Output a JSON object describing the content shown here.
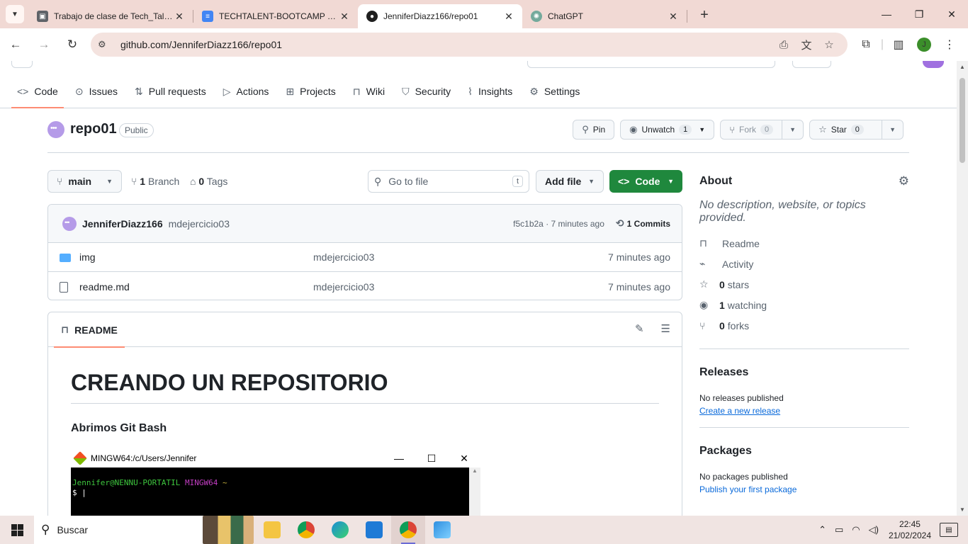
{
  "browser": {
    "tabs": [
      {
        "title": "Trabajo de clase de Tech_Talent",
        "favicon": "classroom-icon",
        "color": "#5f6368"
      },
      {
        "title": "TECHTALENT-BOOTCAMP - Doc",
        "favicon": "docs-icon",
        "color": "#4285f4"
      },
      {
        "title": "JenniferDiazz166/repo01",
        "favicon": "github-icon",
        "color": "#1f1f1f",
        "active": true
      },
      {
        "title": "ChatGPT",
        "favicon": "chatgpt-icon",
        "color": "#74aa9c"
      }
    ],
    "new_tab": "+",
    "url": "github.com/JenniferDiazz166/repo01",
    "profile_initial": "J"
  },
  "repo_nav": [
    {
      "label": "Code",
      "icon": "code-icon",
      "selected": true
    },
    {
      "label": "Issues",
      "icon": "issue-icon"
    },
    {
      "label": "Pull requests",
      "icon": "pull-request-icon"
    },
    {
      "label": "Actions",
      "icon": "play-icon"
    },
    {
      "label": "Projects",
      "icon": "table-icon"
    },
    {
      "label": "Wiki",
      "icon": "book-icon"
    },
    {
      "label": "Security",
      "icon": "shield-icon"
    },
    {
      "label": "Insights",
      "icon": "graph-icon"
    },
    {
      "label": "Settings",
      "icon": "gear-icon"
    }
  ],
  "repo": {
    "name": "repo01",
    "visibility": "Public",
    "pin": "Pin",
    "watch": {
      "label": "Unwatch",
      "count": "1"
    },
    "fork": {
      "label": "Fork",
      "count": "0"
    },
    "star": {
      "label": "Star",
      "count": "0"
    }
  },
  "filenav": {
    "branch": "main",
    "branches_count": "1",
    "branches_label": "Branch",
    "tags_count": "0",
    "tags_label": "Tags",
    "goto_placeholder": "Go to file",
    "goto_kbd": "t",
    "add_file": "Add file",
    "code": "Code"
  },
  "commit": {
    "author": "JenniferDiazz166",
    "message": "mdejercicio03",
    "sha_time": "f5c1b2a · 7 minutes ago",
    "commits": "1 Commits"
  },
  "files": [
    {
      "name": "img",
      "type": "folder",
      "message": "mdejercicio03",
      "date": "7 minutes ago"
    },
    {
      "name": "readme.md",
      "type": "file",
      "message": "mdejercicio03",
      "date": "7 minutes ago"
    }
  ],
  "readme": {
    "tab": "README",
    "h1": "CREANDO UN REPOSITORIO",
    "h3": "Abrimos Git Bash",
    "gitbash": {
      "title": "MINGW64:/c/Users/Jennifer",
      "user": "Jennifer@NENNU-PORTATIL",
      "env": "MINGW64",
      "path": "~",
      "prompt": "$ |"
    }
  },
  "about": {
    "title": "About",
    "description": "No description, website, or topics provided.",
    "items": [
      {
        "icon": "book-icon",
        "bold": "",
        "label": "Readme"
      },
      {
        "icon": "pulse-icon",
        "bold": "",
        "label": "Activity"
      },
      {
        "icon": "star-icon",
        "bold": "0",
        "label": "stars"
      },
      {
        "icon": "eye-icon",
        "bold": "1",
        "label": "watching"
      },
      {
        "icon": "fork-icon",
        "bold": "0",
        "label": "forks"
      }
    ]
  },
  "releases": {
    "title": "Releases",
    "empty": "No releases published",
    "link": "Create a new release"
  },
  "packages": {
    "title": "Packages",
    "empty": "No packages published",
    "link": "Publish your first package"
  },
  "taskbar": {
    "search": "Buscar",
    "apps": [
      {
        "name": "file-explorer-icon",
        "color": "#f4c542"
      },
      {
        "name": "chrome-icon",
        "color": "#db4437"
      },
      {
        "name": "edge-icon",
        "color": "#1b8dd6"
      },
      {
        "name": "vscode-icon",
        "color": "#1f7ad6"
      },
      {
        "name": "chrome-profile-icon",
        "color": "#db4437",
        "active": true
      },
      {
        "name": "photos-icon",
        "color": "#2f8fe0"
      }
    ],
    "time": "22:45",
    "date": "21/02/2024"
  }
}
